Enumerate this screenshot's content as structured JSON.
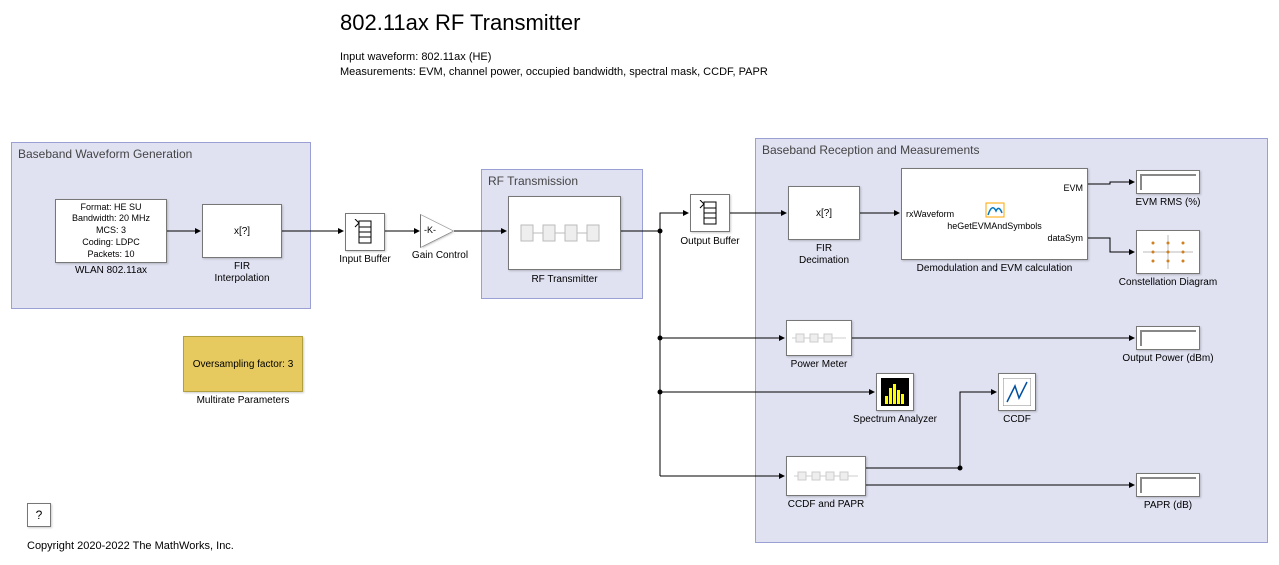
{
  "title": "802.11ax RF Transmitter",
  "subtitle_line1": "Input waveform: 802.11ax (HE)",
  "subtitle_line2": "Measurements: EVM, channel power, occupied bandwidth, spectral mask, CCDF, PAPR",
  "regions": {
    "baseband_gen": {
      "title": "Baseband Waveform Generation"
    },
    "rf_tx": {
      "title": "RF Transmission"
    },
    "baseband_rx": {
      "title": "Baseband Reception and Measurements"
    }
  },
  "blocks": {
    "wlan_source": {
      "lines": [
        "Format: HE SU",
        "Bandwidth: 20 MHz",
        "MCS: 3",
        "Coding: LDPC",
        "Packets: 10"
      ],
      "label": "WLAN 802.11ax"
    },
    "fir_interp": {
      "inner": "x[?]",
      "label_line1": "FIR",
      "label_line2": "Interpolation"
    },
    "input_buffer": {
      "label": "Input Buffer"
    },
    "gain_control": {
      "inner": "-K-",
      "label": "Gain Control"
    },
    "rf_transmitter": {
      "label": "RF Transmitter"
    },
    "output_buffer": {
      "label": "Output Buffer"
    },
    "fir_decim": {
      "inner": "x[?]",
      "label_line1": "FIR",
      "label_line2": "Decimation"
    },
    "demod_evm": {
      "port_in": "rxWaveform",
      "fn": "heGetEVMAndSymbols",
      "port_out1": "EVM",
      "port_out2": "dataSym",
      "label": "Demodulation and EVM calculation"
    },
    "evm_display": {
      "label": "EVM RMS (%)"
    },
    "const_diagram": {
      "label": "Constellation Diagram"
    },
    "power_meter": {
      "label": "Power Meter"
    },
    "power_display": {
      "label": "Output Power (dBm)"
    },
    "spectrum": {
      "label": "Spectrum Analyzer"
    },
    "ccdf_scope": {
      "label": "CCDF"
    },
    "ccdf_papr": {
      "label": "CCDF and PAPR"
    },
    "papr_display": {
      "label": "PAPR (dB)"
    }
  },
  "annotations": {
    "multirate": {
      "text": "Oversampling factor: 3",
      "label": "Multirate Parameters"
    }
  },
  "help": "?",
  "copyright": "Copyright 2020-2022 The MathWorks, Inc."
}
